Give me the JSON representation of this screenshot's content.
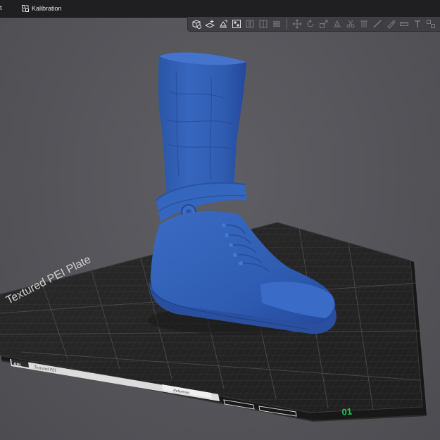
{
  "topbar": {
    "partial_label": "t",
    "calibration_tab_label": "Kalibration",
    "calibration_icon": "calibration-icon"
  },
  "toolbar": {
    "buttons": [
      {
        "icon": "add-object-icon",
        "active": true
      },
      {
        "icon": "add-plate-icon",
        "active": true
      },
      {
        "icon": "auto-orient-icon",
        "active": true
      },
      {
        "icon": "arrange-icon",
        "active": true
      },
      {
        "icon": "split-objects-icon",
        "active": false
      },
      {
        "icon": "split-parts-icon",
        "active": false
      },
      {
        "icon": "layers-icon",
        "active": false
      },
      {
        "icon": "move-icon",
        "active": false
      },
      {
        "icon": "rotate-icon",
        "active": false
      },
      {
        "icon": "scale-icon",
        "active": false
      },
      {
        "icon": "lay-on-face-icon",
        "active": false
      },
      {
        "icon": "cut-icon",
        "active": false
      },
      {
        "icon": "support-paint-icon",
        "active": false
      },
      {
        "icon": "seam-paint-icon",
        "active": false
      },
      {
        "icon": "color-paint-icon",
        "active": false
      },
      {
        "icon": "measure-icon",
        "active": false
      },
      {
        "icon": "text-emboss-icon",
        "active": false
      },
      {
        "icon": "assembly-icon",
        "active": false
      }
    ]
  },
  "build_plate": {
    "plate_label": "Textured PEI Plate",
    "logo_text": "BBL",
    "sticker_text": "Textured PEI",
    "small_label": "Reference",
    "plate_number": "01",
    "plate_number_color": "#21c45a"
  },
  "model": {
    "name": "boot",
    "color": "#2f5fb3"
  }
}
